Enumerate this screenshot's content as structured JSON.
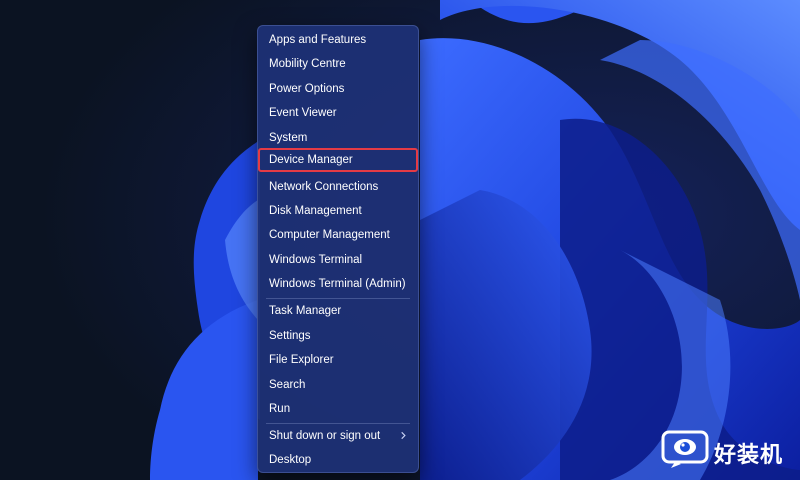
{
  "menu": {
    "items": [
      {
        "label": "Apps and Features"
      },
      {
        "label": "Mobility Centre"
      },
      {
        "label": "Power Options"
      },
      {
        "label": "Event Viewer"
      },
      {
        "label": "System"
      },
      {
        "label": "Device Manager",
        "highlighted": true
      },
      {
        "label": "Network Connections"
      },
      {
        "label": "Disk Management"
      },
      {
        "label": "Computer Management"
      },
      {
        "label": "Windows Terminal"
      },
      {
        "label": "Windows Terminal (Admin)"
      },
      {
        "label": "Task Manager"
      },
      {
        "label": "Settings"
      },
      {
        "label": "File Explorer"
      },
      {
        "label": "Search"
      },
      {
        "label": "Run"
      },
      {
        "label": "Shut down or sign out",
        "submenu": true
      },
      {
        "label": "Desktop"
      }
    ]
  },
  "watermark": {
    "text": "好装机",
    "icon": "eye-monitor-icon"
  },
  "colors": {
    "menu_background": "#1e3176",
    "highlight_border": "#e53b45",
    "wallpaper_blue": "#1f46e0"
  }
}
